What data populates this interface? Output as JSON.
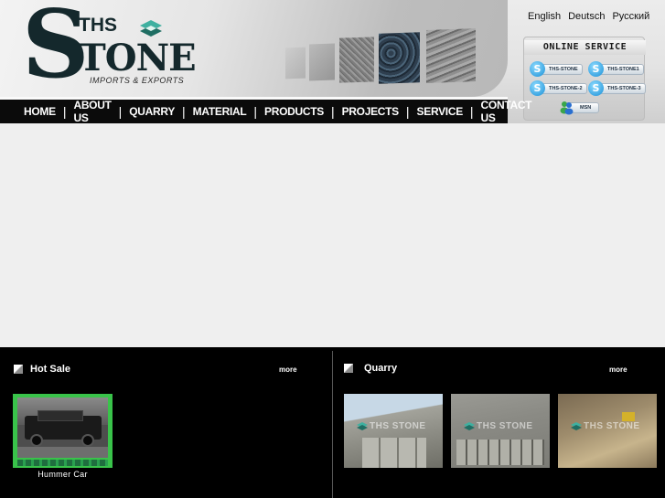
{
  "colors": {
    "nav_background": "#0b0b0b",
    "bottom_background": "#000000",
    "page_background": "#efefef",
    "hot_sale_frame": "#39c34a",
    "logo_mark": "#3fb0a0"
  },
  "logo": {
    "letter_s": "S",
    "ths": "THS",
    "tone": "TONE",
    "tagline": "IMPORTS & EXPORTS"
  },
  "languages": [
    "English",
    "Deutsch",
    "Русский"
  ],
  "nav": [
    "HOME",
    "ABOUT US",
    "QUARRY",
    "MATERIAL",
    "PRODUCTS",
    "PROJECTS",
    "SERVICE",
    "CONTACT US"
  ],
  "online_service": {
    "title": "ONLINE SERVICE",
    "contacts": [
      {
        "label": "THS-STONE",
        "icon": "skype-icon"
      },
      {
        "label": "THS-STONE1",
        "icon": "skype-icon"
      },
      {
        "label": "THS-STONE-2",
        "icon": "skype-icon"
      },
      {
        "label": "THS-STONE-3",
        "icon": "skype-icon"
      },
      {
        "label": "MSN",
        "icon": "msn-icon"
      }
    ]
  },
  "hot_sale": {
    "title": "Hot Sale",
    "more": "more",
    "items": [
      {
        "caption": "Hummer Car"
      }
    ]
  },
  "quarry": {
    "title": "Quarry",
    "more": "more",
    "thumb_watermark": "THS STONE"
  }
}
